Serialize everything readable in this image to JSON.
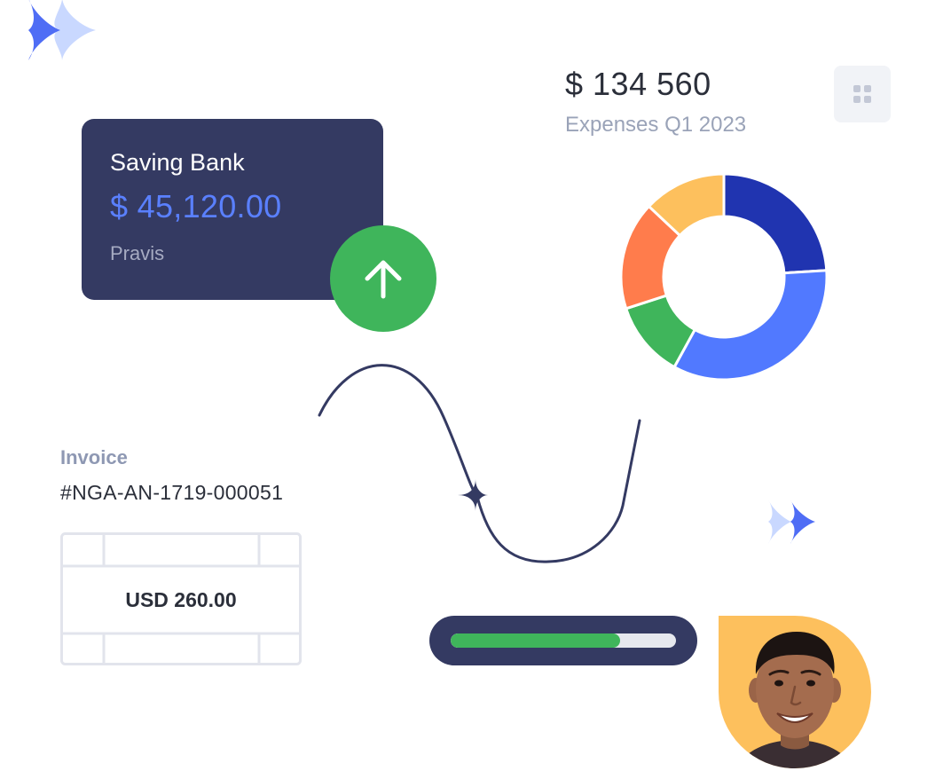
{
  "bank_card": {
    "title": "Saving Bank",
    "amount": "$ 45,120.00",
    "owner": "Pravis"
  },
  "expenses": {
    "total": "$ 134 560",
    "caption": "Expenses Q1 2023"
  },
  "chart_data": {
    "type": "pie",
    "donut": true,
    "slices": [
      {
        "value": 24,
        "color": "#2034b0"
      },
      {
        "value": 34,
        "color": "#5179ff"
      },
      {
        "value": 12,
        "color": "#3fb55b"
      },
      {
        "value": 17,
        "color": "#ff7c4c"
      },
      {
        "value": 13,
        "color": "#fdc05d"
      }
    ]
  },
  "invoice": {
    "label": "Invoice",
    "number": "#NGA-AN-1719-000051",
    "amount": "USD 260.00"
  },
  "progress": {
    "value": 0.75,
    "fill_color": "#3fb55b"
  },
  "icons": {
    "up": "arrow-up-icon",
    "grid": "grid-icon",
    "sparkle": "sparkle-icon"
  },
  "colors": {
    "navy": "#343a62",
    "accent_blue": "#5a80ff",
    "green": "#3fb55b",
    "yellow": "#fdc05d"
  }
}
